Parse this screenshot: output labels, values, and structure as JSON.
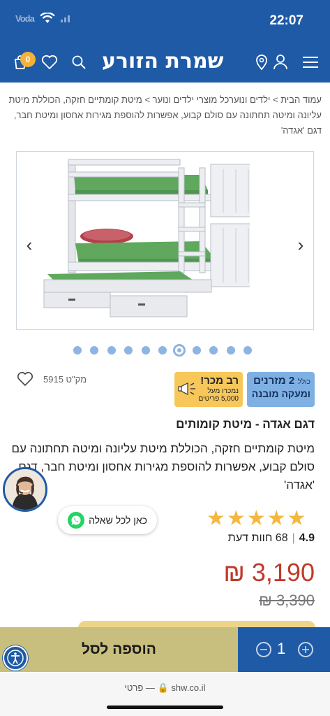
{
  "status_bar": {
    "time": "22:07",
    "carrier": "Voda"
  },
  "header": {
    "brand": "שמרת הזורע",
    "cart_count": "0"
  },
  "breadcrumb": {
    "home": "עמוד הבית",
    "sep": ">",
    "category": "ילדים ונוער",
    "subcategory": "כל מוצרי ילדים ונוער",
    "product": "מיטת קומתיים חזקה, הכוללת מיטת עליונה ומיטה תחתונה עם סולם קבוע, אפשרות להוספת מגירות אחסון ומיטת חבר, דגם 'אגדה'"
  },
  "gallery": {
    "dot_count": 11,
    "active_dot": 6
  },
  "badges": {
    "mattress_prefix": "כולל",
    "mattress_main": "2 מזרנים",
    "mattress_sub": "ומעקה מובנה",
    "bestseller_title": "רב מכר!",
    "bestseller_line1": "נמכרו מעל",
    "bestseller_line2": "5,000 פריטים"
  },
  "product": {
    "sku": "מק\"ט 5915",
    "title": "דגם אגדה - מיטת קומותים",
    "description": "מיטת קומתיים חזקה, הכוללת מיטת עליונה ומיטה תחתונה עם סולם קבוע, אפשרות להוספת מגירות אחסון ומיטת חבר, דגם 'אגדה'",
    "rating": "4.9",
    "reviews": "68 חוות דעת",
    "rating_stars": 5,
    "price": "3,190 ₪",
    "old_price": "3,390 ₪"
  },
  "whatsapp": {
    "label": "כאן לכל שאלה"
  },
  "cart_bar": {
    "add_label": "הוספה לסל",
    "quantity": "1"
  },
  "browser": {
    "url": "shw.co.il",
    "privacy": "פרטי"
  },
  "colors": {
    "brand_blue": "#1f5aa6",
    "price_red": "#c0392b",
    "star": "#f4b740",
    "add_btn": "#c8bf7e"
  }
}
